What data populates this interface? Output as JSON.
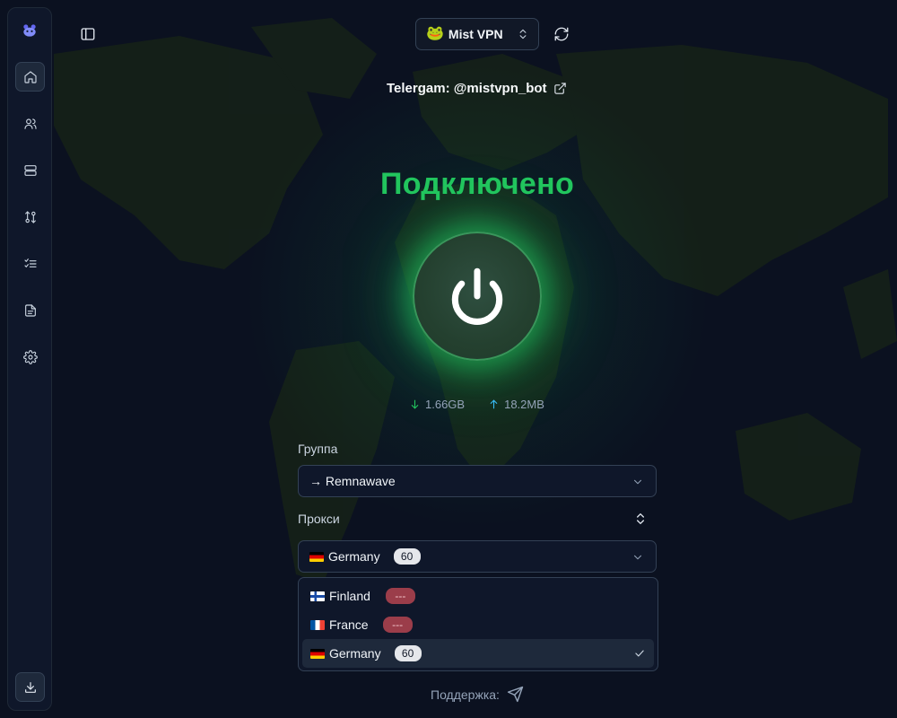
{
  "topbar": {
    "profile_name": "Mist VPN",
    "profile_icon": "frog-emoji",
    "telegram_link": "Telergam: @mistvpn_bot"
  },
  "status": {
    "text": "Подключено",
    "color": "#22c55e"
  },
  "traffic": {
    "download": "1.66GB",
    "upload": "18.2MB",
    "download_color": "#22c55e",
    "upload_color": "#38bdf8"
  },
  "group": {
    "label": "Группа",
    "value": "→ Remnawave"
  },
  "proxy": {
    "label": "Прокси",
    "selected": {
      "name": "Germany",
      "flag": "flag-germany",
      "delay": "60"
    },
    "options": [
      {
        "name": "Finland",
        "flag": "flag-finland",
        "delay": "---",
        "state": "timeout"
      },
      {
        "name": "France",
        "flag": "flag-france",
        "delay": "---",
        "state": "timeout"
      },
      {
        "name": "Germany",
        "flag": "flag-germany",
        "delay": "60",
        "state": "ok",
        "selected": true
      }
    ]
  },
  "footer": {
    "support_label": "Поддержка:"
  },
  "sidebar": {
    "items": [
      "home-icon",
      "users-icon",
      "server-icon",
      "route-icon",
      "list-checks-icon",
      "file-text-icon",
      "settings-icon"
    ],
    "bottom": "download-icon"
  },
  "colors": {
    "background": "#0b1120",
    "panel": "#0f172a",
    "border": "#334155",
    "bad_badge": "#9b3d4a"
  }
}
